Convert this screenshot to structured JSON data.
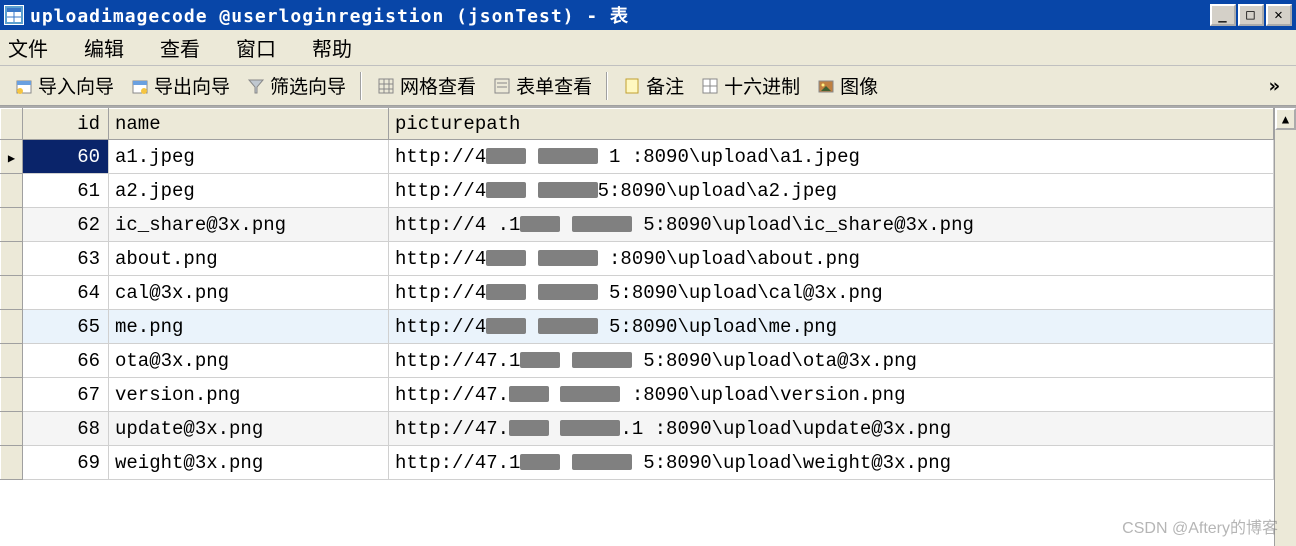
{
  "window": {
    "title": "uploadimagecode @userloginregistion (jsonTest) - 表"
  },
  "menu": {
    "file": "文件",
    "edit": "编辑",
    "view": "查看",
    "window": "窗口",
    "help": "帮助"
  },
  "toolbar": {
    "import_wizard": "导入向导",
    "export_wizard": "导出向导",
    "filter_wizard": "筛选向导",
    "grid_view": "网格查看",
    "form_view": "表单查看",
    "memo": "备注",
    "hex": "十六进制",
    "image": "图像",
    "overflow": "»"
  },
  "columns": {
    "id": "id",
    "name": "name",
    "picturepath": "picturepath"
  },
  "rows": [
    {
      "id": "60",
      "name": "a1.jpeg",
      "path_pre": "http://4",
      "path_post": " 1   :8090\\upload\\a1.jpeg",
      "active": true,
      "selected": true
    },
    {
      "id": "61",
      "name": "a2.jpeg",
      "path_pre": "http://4",
      "path_post": "5:8090\\upload\\a2.jpeg"
    },
    {
      "id": "62",
      "name": "ic_share@3x.png",
      "path_pre": "http://4 .1",
      "path_post": " 5:8090\\upload\\ic_share@3x.png",
      "alt": true
    },
    {
      "id": "63",
      "name": "about.png",
      "path_pre": "http://4",
      "path_post": "  :8090\\upload\\about.png"
    },
    {
      "id": "64",
      "name": "cal@3x.png",
      "path_pre": "http://4",
      "path_post": " 5:8090\\upload\\cal@3x.png"
    },
    {
      "id": "65",
      "name": "me.png",
      "path_pre": "http://4",
      "path_post": " 5:8090\\upload\\me.png",
      "hl": true
    },
    {
      "id": "66",
      "name": "ota@3x.png",
      "path_pre": "http://47.1",
      "path_post": " 5:8090\\upload\\ota@3x.png"
    },
    {
      "id": "67",
      "name": "version.png",
      "path_pre": "http://47.",
      "path_post": " :8090\\upload\\version.png"
    },
    {
      "id": "68",
      "name": "update@3x.png",
      "path_pre": "http://47.",
      "path_post": ".1  :8090\\upload\\update@3x.png",
      "alt": true
    },
    {
      "id": "69",
      "name": "weight@3x.png",
      "path_pre": "http://47.1",
      "path_post": " 5:8090\\upload\\weight@3x.png"
    }
  ],
  "watermark": "CSDN @Aftery的博客"
}
